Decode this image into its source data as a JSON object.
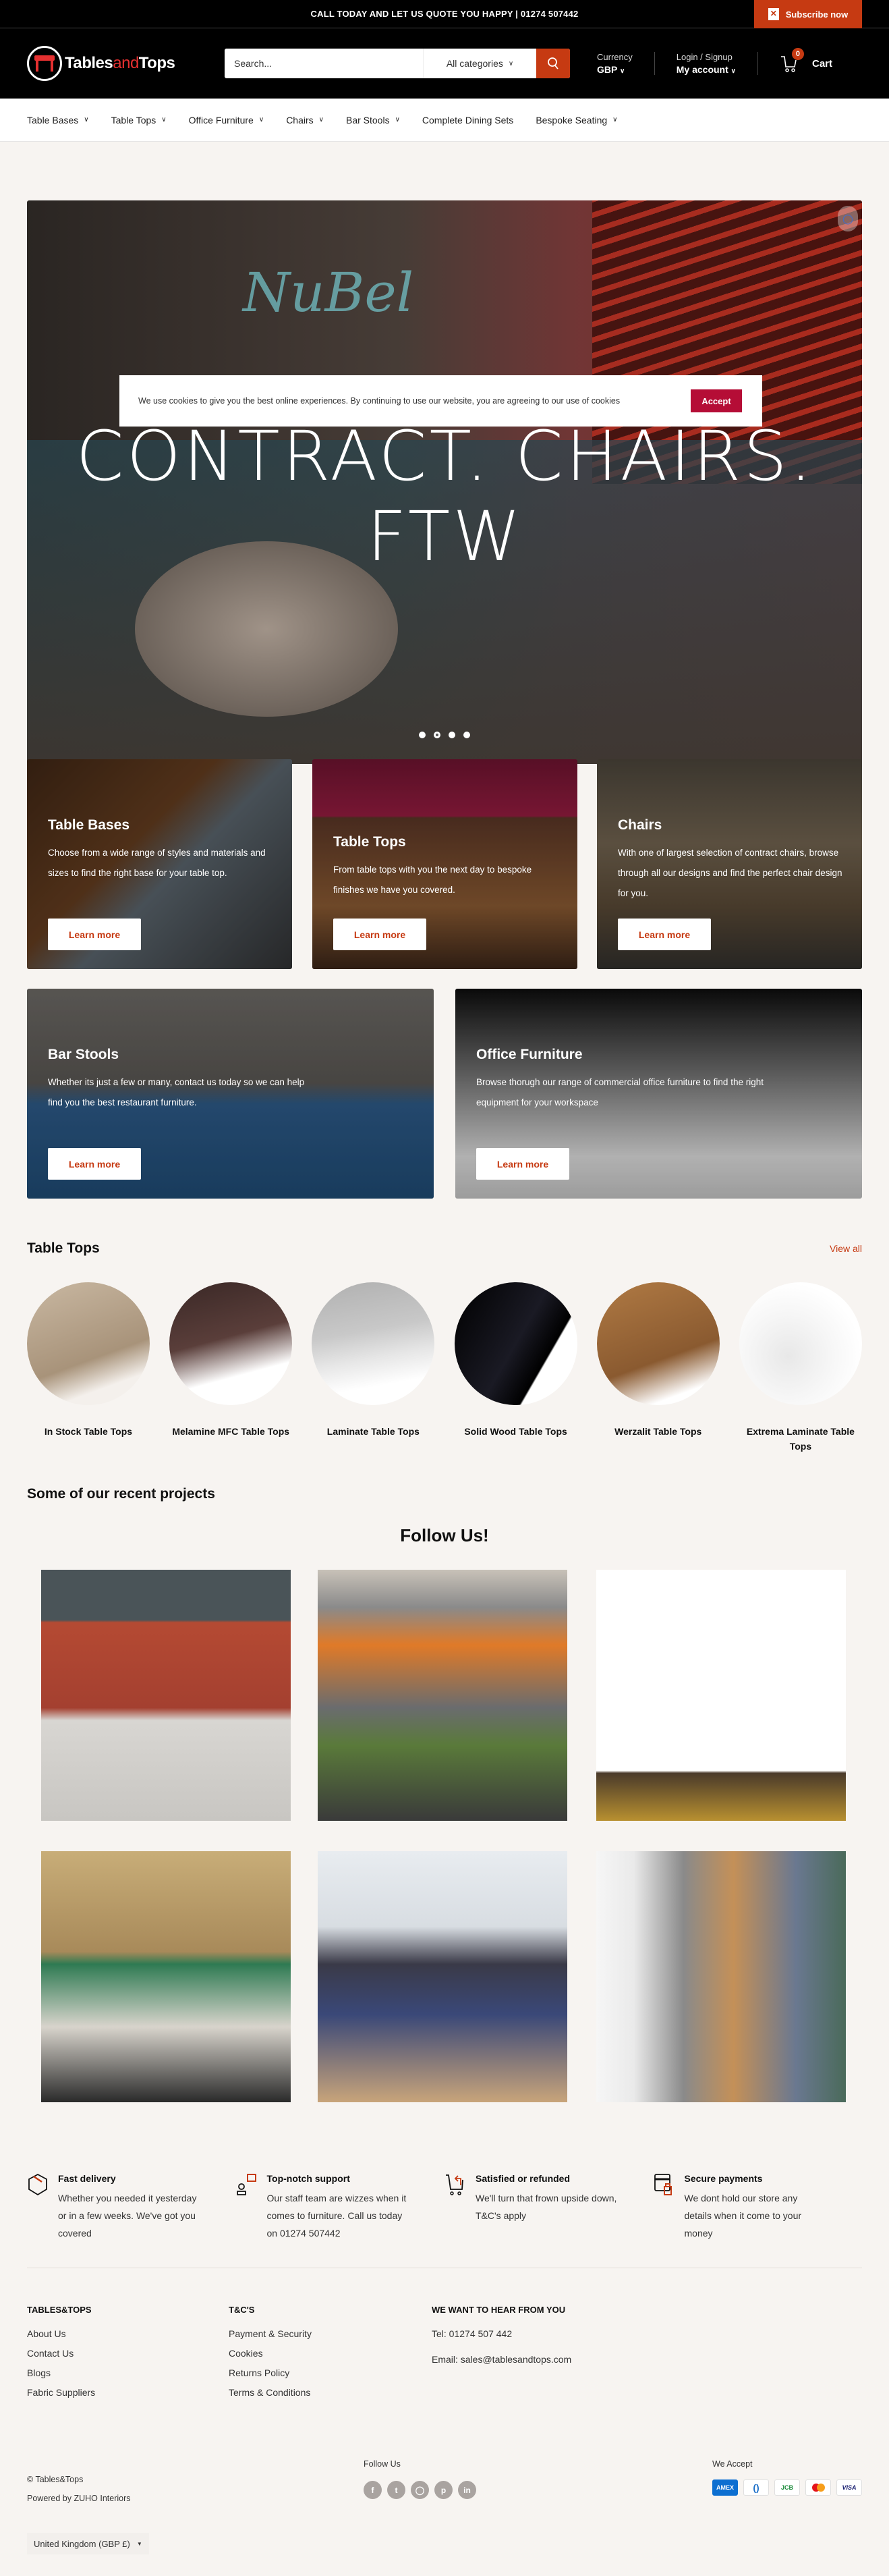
{
  "announcement": {
    "text": "CALL TODAY AND LET US QUOTE YOU HAPPY | 01274 507442",
    "subscribe_label": "Subscribe now"
  },
  "header": {
    "logo": {
      "part1": "Tables",
      "part2": "and",
      "part3": "Tops"
    },
    "search": {
      "placeholder": "Search...",
      "category": "All categories"
    },
    "currency": {
      "label": "Currency",
      "value": "GBP"
    },
    "account": {
      "label": "Login / Signup",
      "value": "My account"
    },
    "cart": {
      "label": "Cart",
      "count": "0"
    }
  },
  "nav": {
    "items": [
      {
        "label": "Table Bases",
        "has_dropdown": true
      },
      {
        "label": "Table Tops",
        "has_dropdown": true
      },
      {
        "label": "Office Furniture",
        "has_dropdown": true
      },
      {
        "label": "Chairs",
        "has_dropdown": true
      },
      {
        "label": "Bar Stools",
        "has_dropdown": true
      },
      {
        "label": "Complete Dining Sets",
        "has_dropdown": false
      },
      {
        "label": "Bespoke Seating",
        "has_dropdown": true
      }
    ]
  },
  "hero": {
    "title": "CONTRACT. CHAIRS. FTW",
    "sign_text": "NuBel",
    "slides": 4,
    "active_slide": 2
  },
  "cookie": {
    "text": "We use cookies to give you the best online experiences. By continuing to use our website, you are agreeing to our use of cookies",
    "accept_label": "Accept"
  },
  "collections": [
    {
      "title": "Table Bases",
      "desc": "Choose from a wide range of styles and materials and sizes to find the right base for your table top.",
      "cta": "Learn more"
    },
    {
      "title": "Table Tops",
      "desc": "From table tops with you the next day to bespoke finishes we have you covered.",
      "cta": "Learn more"
    },
    {
      "title": "Chairs",
      "desc": "With one of largest selection of contract chairs, browse through all our designs and find the perfect chair design for you.",
      "cta": "Learn more"
    },
    {
      "title": "Bar Stools",
      "desc": "Whether its just a few or many, contact us today so we can help find you the best restaurant furniture.",
      "cta": "Learn more"
    },
    {
      "title": "Office Furniture",
      "desc": "Browse thorugh our range of commercial office furniture to find the right equipment for your workspace",
      "cta": "Learn more"
    }
  ],
  "table_tops": {
    "title": "Table Tops",
    "view_all": "View all",
    "items": [
      {
        "label": "In Stock Table Tops",
        "color": "#b8a48c"
      },
      {
        "label": "Melamine MFC Table Tops",
        "color": "#4a3330"
      },
      {
        "label": "Laminate Table Tops",
        "color": "#bdbdbd"
      },
      {
        "label": "Solid Wood Table Tops",
        "color": "#0c0c10"
      },
      {
        "label": "Werzalit Table Tops",
        "color": "#9a6a3e"
      },
      {
        "label": "Extrema Laminate Table Tops",
        "color": "#ececec"
      }
    ]
  },
  "projects": {
    "title": "Some of our recent projects"
  },
  "follow": {
    "title": "Follow Us!",
    "posts": [
      {
        "alt": "Courtyard with dark chairs and marble tables"
      },
      {
        "alt": "Outdoor seating with orange chairs and planters"
      },
      {
        "alt": "Interior with yellow velvet chair"
      },
      {
        "alt": "Camden Market terrace with green umbrellas"
      },
      {
        "alt": "Dining room with navy velvet chairs"
      },
      {
        "alt": "Harbour balcony with wooden tables"
      }
    ]
  },
  "features": [
    {
      "title": "Fast delivery",
      "desc": "Whether you needed it yesterday or in a few weeks. We've got you covered",
      "icon": "box-icon"
    },
    {
      "title": "Top-notch support",
      "desc": "Our staff team are wizzes when it comes to furniture. Call us today on 01274 507442",
      "icon": "support-icon"
    },
    {
      "title": "Satisfied or refunded",
      "desc": "We'll turn that frown upside down, T&C's apply",
      "icon": "cart-return-icon"
    },
    {
      "title": "Secure payments",
      "desc": "We dont hold our store any details when it come to your money",
      "icon": "secure-payment-icon"
    }
  ],
  "footer": {
    "col1": {
      "heading": "TABLES&TOPS",
      "links": [
        "About Us",
        "Contact Us",
        "Blogs",
        "Fabric Suppliers"
      ]
    },
    "col2": {
      "heading": "T&C'S",
      "links": [
        "Payment & Security",
        "Cookies",
        "Returns Policy",
        "Terms & Conditions"
      ]
    },
    "col3": {
      "heading": "WE WANT TO HEAR FROM YOU",
      "tel": "Tel: 01274 507 442",
      "email": "Email: sales@tablesandtops.com"
    },
    "copyright": "© Tables&Tops",
    "powered": "Powered by ZUHO Interiors",
    "follow_label": "Follow Us",
    "socials": [
      "facebook",
      "twitter",
      "instagram",
      "pinterest",
      "linkedin"
    ],
    "accept_label": "We Accept",
    "payments": [
      "AMEX",
      "Diners",
      "JCB",
      "Mastercard",
      "VISA"
    ],
    "country": "United Kingdom (GBP £)"
  },
  "colors": {
    "accent": "#c63a12",
    "cookie_accept": "#b50d36",
    "background": "#f7f4f1"
  }
}
